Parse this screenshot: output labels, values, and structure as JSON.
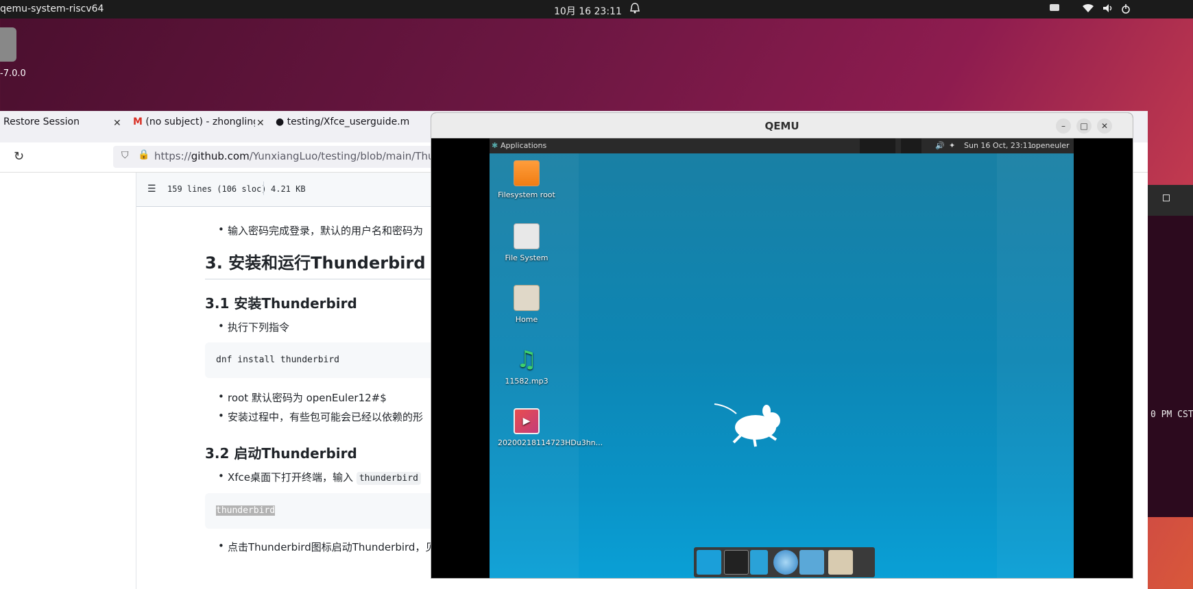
{
  "topbar": {
    "app_name": "qemu-system-riscv64",
    "datetime": "10月 16  23:11"
  },
  "desktop": {
    "icon_label": "-7.0.0"
  },
  "browser": {
    "tabs": [
      {
        "label": "Restore Session"
      },
      {
        "label": "(no subject) - zhonglingh"
      },
      {
        "label": "testing/Xfce_userguide.m"
      }
    ],
    "url_prefix": "https://",
    "url_domain": "github.com",
    "url_path": "/YunxiangLuo/testing/blob/main/Thun",
    "file_info": {
      "lines": "159 lines (106 sloc)",
      "size": "4.21 KB"
    },
    "doc": {
      "li_login": "输入密码完成登录，默认的用户名和密码为",
      "h2": "3. 安装和运行Thunderbird",
      "h3_install": "3.1 安装Thunderbird",
      "li_exec": "执行下列指令",
      "code_install": "dnf install thunderbird",
      "li_root": "root 默认密码为 openEuler12#$",
      "li_deps": "安装过程中，有些包可能会已经以依赖的形",
      "h3_start": "3.2 启动Thunderbird",
      "li_terminal_pre": "Xfce桌面下打开终端，输入 ",
      "li_terminal_code": "thunderbird",
      "code_run": "thunderbird",
      "li_click": "点击Thunderbird图标启动Thunderbird，见"
    }
  },
  "terminal_remnant": {
    "text": "0 PM CST"
  },
  "qemu": {
    "title": "QEMU",
    "xfce": {
      "applications": "Applications",
      "clock": "Sun 16 Oct, 23:11",
      "user": "openeuler",
      "icons": [
        {
          "label": "Filesystem root",
          "icon": "drive-harddisk-icon"
        },
        {
          "label": "File System",
          "icon": "drive-icon"
        },
        {
          "label": "Home",
          "icon": "home-folder-icon"
        },
        {
          "label": "11582.mp3",
          "icon": "audio-file-icon"
        },
        {
          "label": "20200218114723HDu3hn...",
          "icon": "video-file-icon"
        }
      ]
    }
  }
}
